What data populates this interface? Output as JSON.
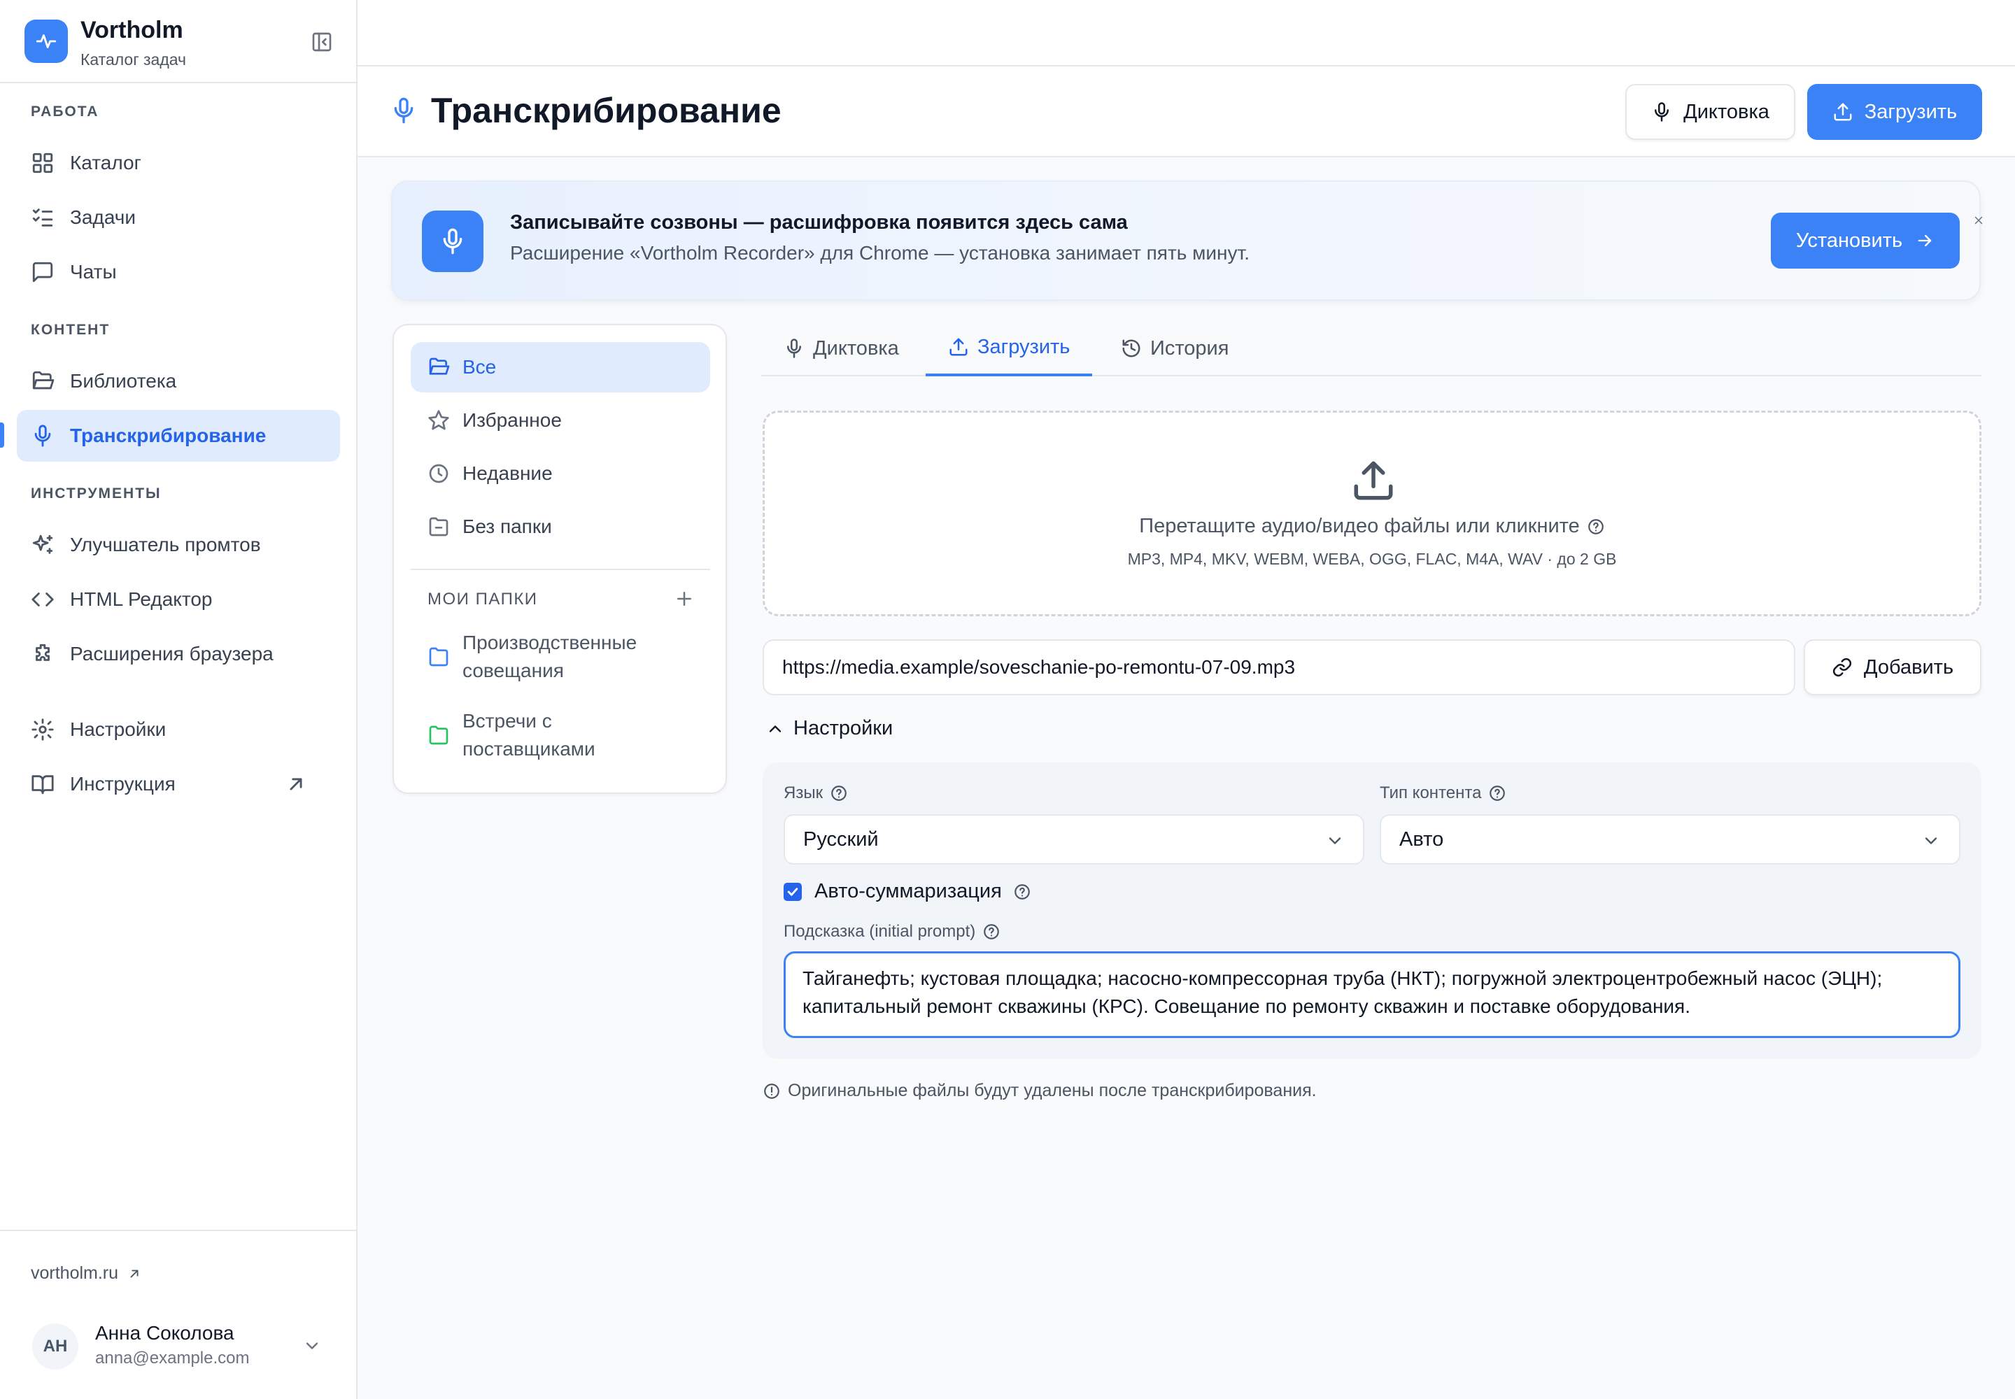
{
  "app": {
    "name": "Vortholm",
    "subtitle": "Каталог задач"
  },
  "sidebar": {
    "sections": {
      "work": "РАБОТА",
      "content": "КОНТЕНТ",
      "tools": "ИНСТРУМЕНТЫ"
    },
    "items": [
      {
        "label": "Каталог",
        "icon": "grid-icon"
      },
      {
        "label": "Задачи",
        "icon": "list-checks-icon"
      },
      {
        "label": "Чаты",
        "icon": "message-square-icon"
      },
      {
        "label": "Библиотека",
        "icon": "folder-open-icon"
      },
      {
        "label": "Транскрибирование",
        "icon": "mic-icon",
        "active": true
      },
      {
        "label": "Улучшатель промтов",
        "icon": "sparkles-icon"
      },
      {
        "label": "HTML Редактор",
        "icon": "code-icon"
      },
      {
        "label": "Расширения браузера",
        "icon": "puzzle-icon"
      },
      {
        "label": "Настройки",
        "icon": "gear-icon"
      },
      {
        "label": "Инструкция",
        "icon": "book-open-icon"
      }
    ],
    "site_link": "vortholm.ru",
    "user": {
      "initials": "АН",
      "name": "Анна Соколова",
      "email": "anna@example.com"
    }
  },
  "header": {
    "title": "Транскрибирование",
    "dictation_label": "Диктовка",
    "upload_label": "Загрузить"
  },
  "banner": {
    "title": "Записывайте созвоны — расшифровка появится здесь сама",
    "text": "Расширение «Vortholm Recorder» для Chrome — установка занимает пять минут.",
    "button": "Установить"
  },
  "folders": {
    "items": [
      "Все",
      "Избранное",
      "Недавние",
      "Без папки"
    ],
    "my_folders_label": "МОИ ПАПКИ",
    "custom": [
      {
        "line1": "Производственные",
        "line2": "совещания",
        "color": "#3b82f6"
      },
      {
        "line1": "Встречи с",
        "line2": "поставщиками",
        "color": "#22c55e"
      }
    ]
  },
  "tabs": [
    "Диктовка",
    "Загрузить",
    "История"
  ],
  "active_tab": "Загрузить",
  "dropzone": {
    "text": "Перетащите аудио/видео файлы или кликните",
    "formats": "MP3, MP4, MKV, WEBM, WEBA, OGG, FLAC, M4A, WAV · до 2 GB"
  },
  "url": {
    "value": "https://media.example/soveschanie-po-remontu-07-09.mp3",
    "add_label": "Добавить"
  },
  "settings": {
    "toggle_label": "Настройки",
    "language_label": "Язык",
    "language_value": "Русский",
    "content_type_label": "Тип контента",
    "content_type_value": "Авто",
    "auto_summary_label": "Авто-суммаризация",
    "auto_summary_checked": true,
    "prompt_label": "Подсказка (initial prompt)",
    "prompt_line1": "Тайганефть; кустовая площадка; насосно-компрессорная труба (НКТ); погружной электроцентробежный насос (ЭЦН);",
    "prompt_line2": "капитальный ремонт скважины (КРС). Совещание по ремонту скважин и поставке оборудования."
  },
  "note": "Оригинальные файлы будут удалены после транскрибирования.",
  "colors": {
    "accent": "#3b82f6",
    "accent_dark": "#2563eb",
    "active_bg": "#e0ecfd"
  }
}
